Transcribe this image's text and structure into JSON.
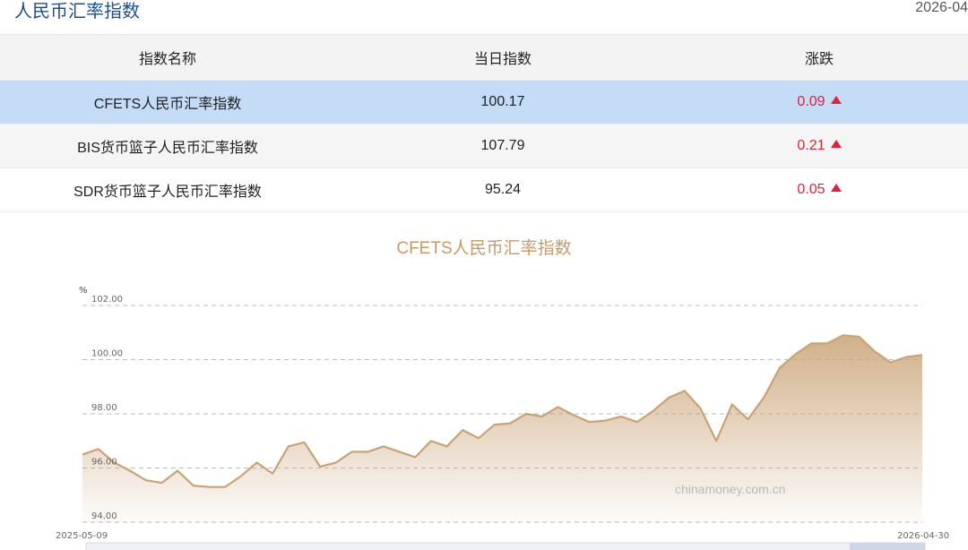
{
  "page": {
    "title": "人民币汇率指数",
    "date": "2026-04"
  },
  "table": {
    "headers": [
      "指数名称",
      "当日指数",
      "涨跌"
    ],
    "rows": [
      {
        "name": "CFETS人民币汇率指数",
        "value": "100.17",
        "change": "0.09"
      },
      {
        "name": "BIS货币篮子人民币汇率指数",
        "value": "107.79",
        "change": "0.21"
      },
      {
        "name": "SDR货币篮子人民币汇率指数",
        "value": "95.24",
        "change": "0.05"
      }
    ]
  },
  "chart_data": {
    "type": "area",
    "title": "CFETS人民币汇率指数",
    "ylabel": "%",
    "xlabel": "",
    "ylim": [
      94,
      102
    ],
    "yticks": [
      "94.00",
      "96.00",
      "98.00",
      "100.00",
      "102.00"
    ],
    "x_start_label": "2025-05-09",
    "x_end_label": "2026-04-30",
    "grid": true,
    "watermark": "chinamoney.com.cn",
    "colors": {
      "line": "#c9a275",
      "fill_top": "#c9a275",
      "grid": "#bbbbbb",
      "accent_up": "#e0223a",
      "header_blue": "#1f4e8c"
    },
    "values": [
      96.5,
      96.7,
      96.2,
      95.9,
      95.55,
      95.45,
      95.9,
      95.35,
      95.3,
      95.3,
      95.7,
      96.2,
      95.8,
      96.8,
      96.95,
      96.05,
      96.2,
      96.6,
      96.6,
      96.8,
      96.6,
      96.4,
      97.0,
      96.8,
      97.4,
      97.1,
      97.6,
      97.65,
      98.0,
      97.9,
      98.25,
      97.95,
      97.7,
      97.75,
      97.9,
      97.7,
      98.1,
      98.6,
      98.85,
      98.2,
      97.0,
      98.35,
      97.8,
      98.6,
      99.7,
      100.2,
      100.6,
      100.6,
      100.9,
      100.85,
      100.3,
      99.9,
      100.1,
      100.17
    ]
  }
}
